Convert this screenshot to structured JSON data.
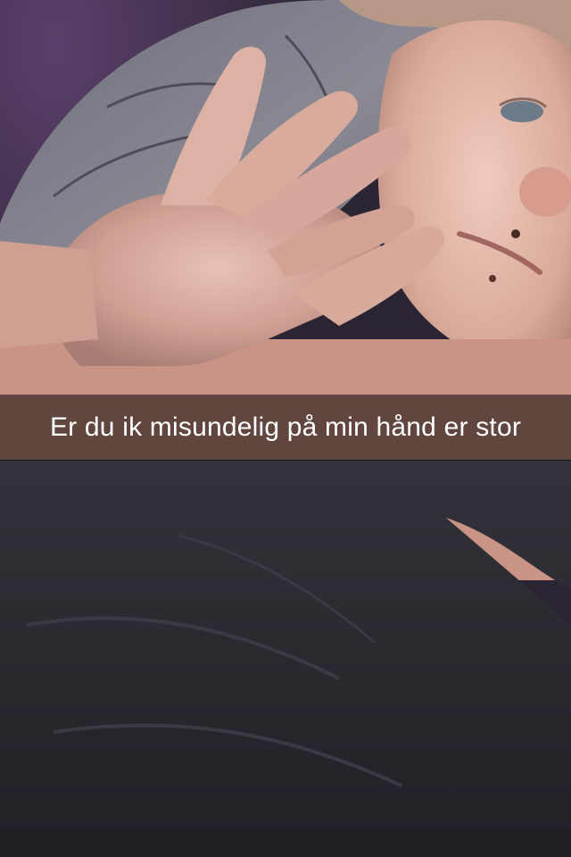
{
  "snap": {
    "caption": "Er du ik misundelig på min hånd er stor",
    "caption_bar_color": "#000000",
    "caption_text_color": "#ffffff"
  },
  "photo": {
    "subjects": [
      "hand",
      "face",
      "pillow",
      "dark-shirt"
    ]
  }
}
